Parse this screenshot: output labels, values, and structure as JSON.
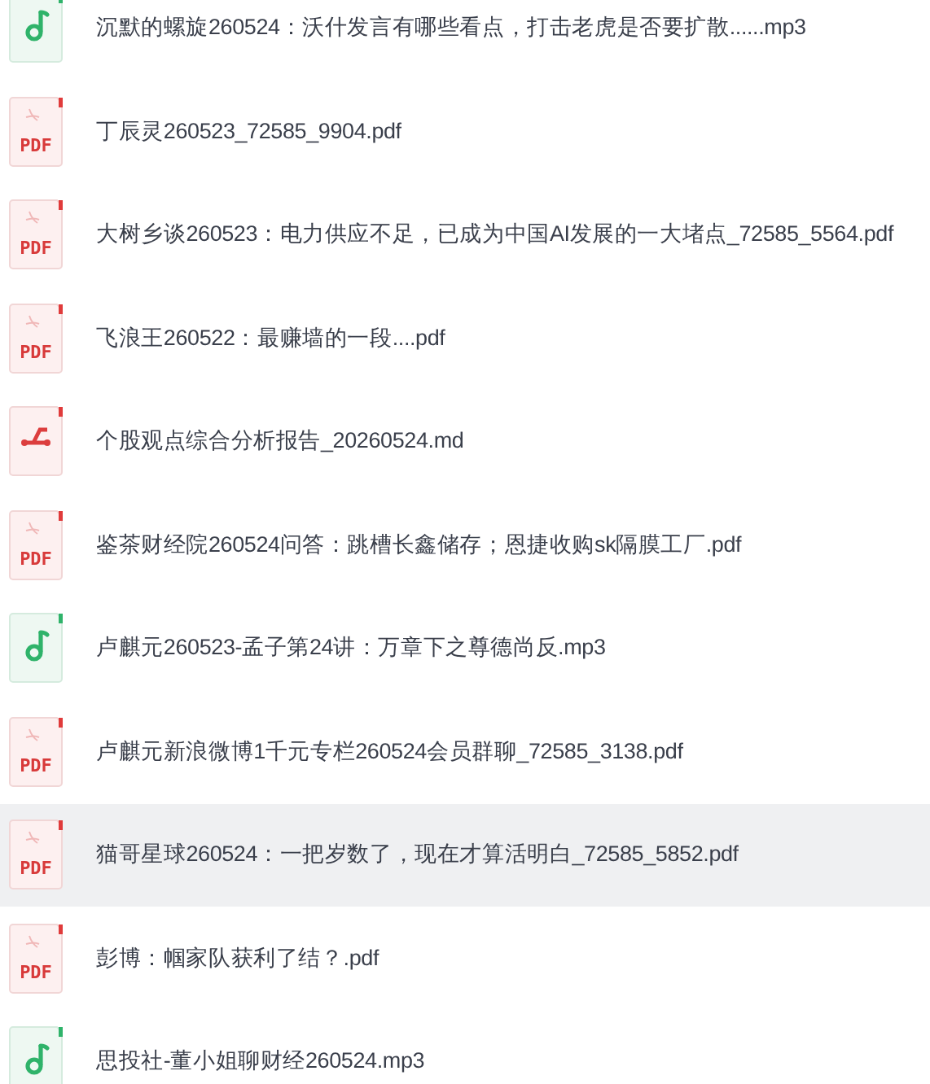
{
  "files": [
    {
      "name": "沉默的螺旋260524：沃什发言有哪些看点，打击老虎是否要扩散......mp3",
      "kind": "audio",
      "selected": false
    },
    {
      "name": "丁辰灵260523_72585_9904.pdf",
      "kind": "pdf",
      "badge": "PDF",
      "selected": false
    },
    {
      "name": "大树乡谈260523：电力供应不足，已成为中国AI发展的一大堵点_72585_5564.pdf",
      "kind": "pdf",
      "badge": "PDF",
      "selected": false
    },
    {
      "name": "飞浪王260522：最赚墙的一段....pdf",
      "kind": "pdf",
      "badge": "PDF",
      "selected": false
    },
    {
      "name": "个股观点综合分析报告_20260524.md",
      "kind": "markdown",
      "selected": false
    },
    {
      "name": "鉴茶财经院260524问答：跳槽长鑫储存；恩捷收购sk隔膜工厂.pdf",
      "kind": "pdf",
      "badge": "PDF",
      "selected": false
    },
    {
      "name": "卢麒元260523-孟子第24讲：万章下之尊德尚反.mp3",
      "kind": "audio",
      "selected": false
    },
    {
      "name": "卢麒元新浪微博1千元专栏260524会员群聊_72585_3138.pdf",
      "kind": "pdf",
      "badge": "PDF",
      "selected": false
    },
    {
      "name": "猫哥星球260524：一把岁数了，现在才算活明白_72585_5852.pdf",
      "kind": "pdf",
      "badge": "PDF",
      "selected": true
    },
    {
      "name": "彭博：帼家队获利了结？.pdf",
      "kind": "pdf",
      "badge": "PDF",
      "selected": false
    },
    {
      "name": "思投社-董小姐聊财经260524.mp3",
      "kind": "audio",
      "selected": false
    }
  ]
}
